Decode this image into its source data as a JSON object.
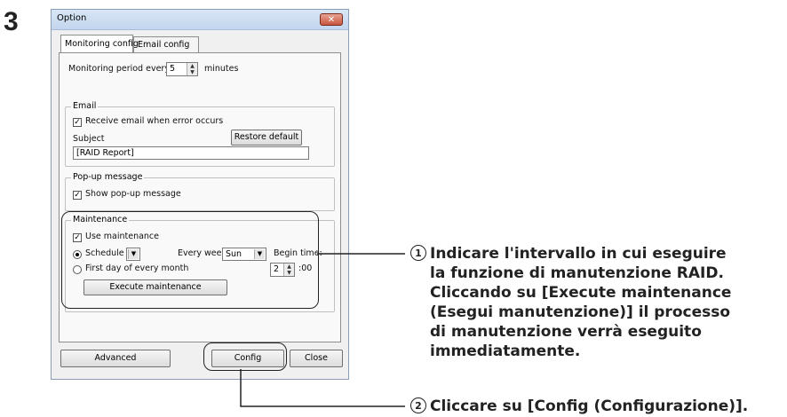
{
  "step_number": "3",
  "window": {
    "title": "Option",
    "close_symbol": "✕",
    "tabs": [
      "Monitoring config",
      "Email config"
    ],
    "monitoring": {
      "prefix": "Monitoring period every",
      "value": "5",
      "suffix": "minutes"
    },
    "email": {
      "legend": "Email",
      "receive_label": "Receive email when error occurs",
      "subject_label": "Subject",
      "restore_label": "Restore default",
      "subject_value": "[RAID Report]"
    },
    "popup": {
      "legend": "Pop-up message",
      "show_label": "Show pop-up message"
    },
    "maintenance": {
      "legend": "Maintenance",
      "use_label": "Use maintenance",
      "schedule_label": "Schedule",
      "every_week_label": "Every week",
      "day_value": "Sun",
      "begin_time_label": "Begin time:",
      "first_day_label": "First day of every month",
      "hour_value": "2",
      "minute_suffix": ":00",
      "execute_label": "Execute maintenance"
    },
    "buttons": {
      "advanced": "Advanced",
      "config": "Config",
      "close": "Close"
    }
  },
  "annotations": {
    "a1_num": "1",
    "a1_lines": [
      "Indicare l'intervallo in cui eseguire",
      "la funzione di manutenzione RAID.",
      "Cliccando su [Execute maintenance",
      "(Esegui manutenzione)] il processo",
      "di manutenzione verrà eseguito",
      "immediatamente."
    ],
    "a2_num": "2",
    "a2_text": "Cliccare su [Config (Configurazione)]."
  }
}
